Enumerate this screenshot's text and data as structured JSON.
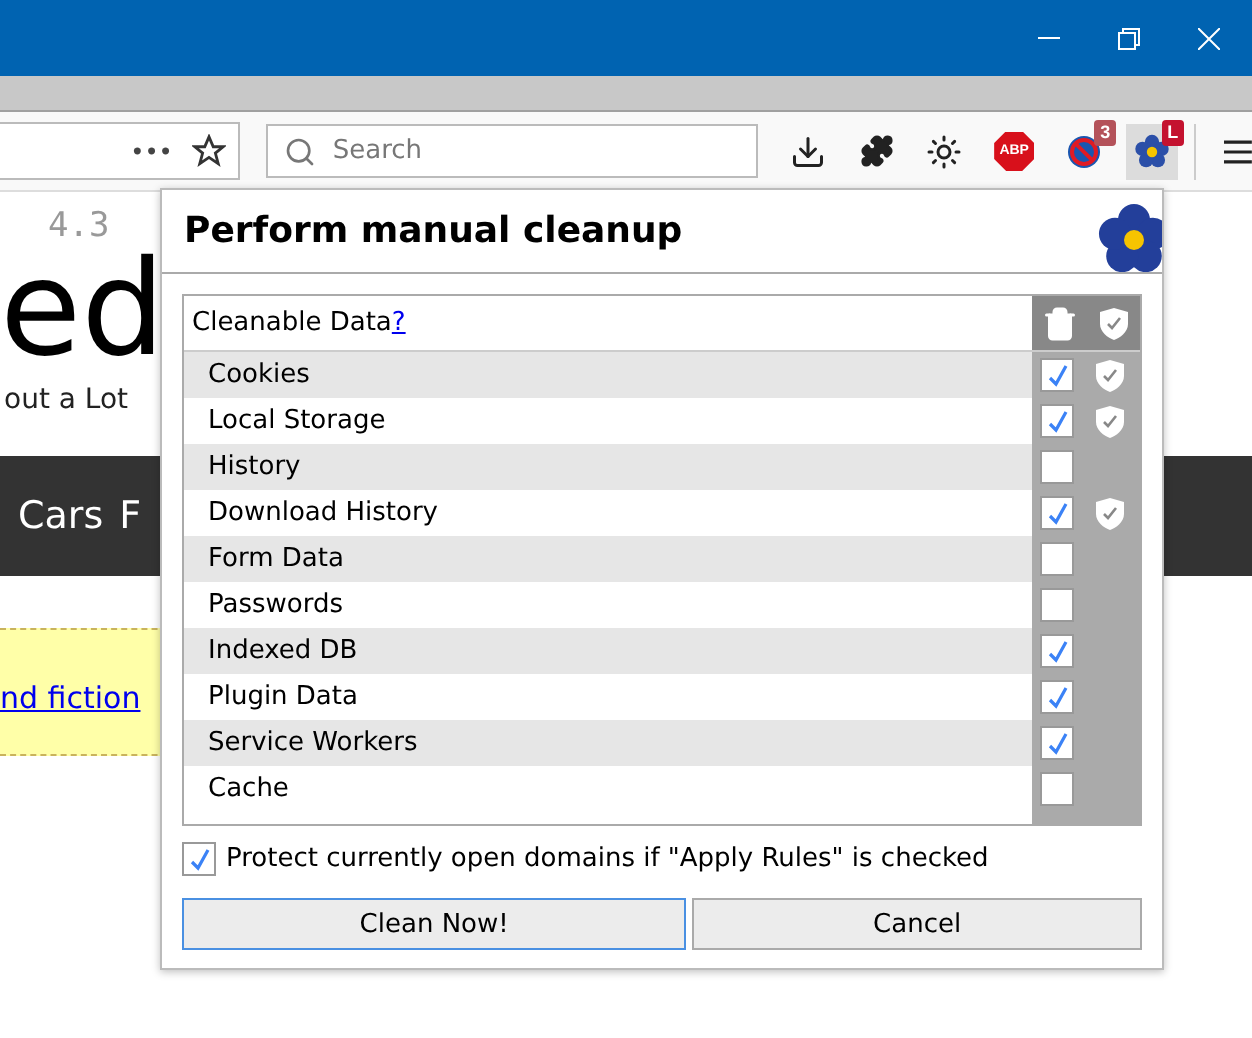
{
  "toolbar": {
    "url_more": "•••",
    "search": {
      "placeholder": "Search"
    },
    "stop_sign_label": "ABP",
    "badges": [
      {
        "text": "3",
        "color": "#b4525a"
      },
      {
        "text": "L",
        "color": "#c4122f"
      }
    ]
  },
  "page": {
    "rating": "4.3",
    "heading": "ed",
    "tagline": "out a Lot",
    "nav": [
      "Cars",
      "F"
    ],
    "notice_link": "nd fiction"
  },
  "popup": {
    "title": "Perform manual cleanup",
    "table": {
      "header": "Cleanable Data",
      "help_link": "?",
      "rows": [
        {
          "label": "Cookies",
          "checked": true,
          "protected": true
        },
        {
          "label": "Local Storage",
          "checked": true,
          "protected": true
        },
        {
          "label": "History",
          "checked": false,
          "protected": false
        },
        {
          "label": "Download History",
          "checked": true,
          "protected": true
        },
        {
          "label": "Form Data",
          "checked": false,
          "protected": false
        },
        {
          "label": "Passwords",
          "checked": false,
          "protected": false
        },
        {
          "label": "Indexed DB",
          "checked": true,
          "protected": false
        },
        {
          "label": "Plugin Data",
          "checked": true,
          "protected": false
        },
        {
          "label": "Service Workers",
          "checked": true,
          "protected": false
        },
        {
          "label": "Cache",
          "checked": false,
          "protected": false
        }
      ]
    },
    "protect_option": {
      "label": "Protect currently open domains if \"Apply Rules\" is checked",
      "checked": true
    },
    "buttons": [
      {
        "label": "Clean Now!",
        "selected": true
      },
      {
        "label": "Cancel",
        "selected": false
      }
    ]
  }
}
